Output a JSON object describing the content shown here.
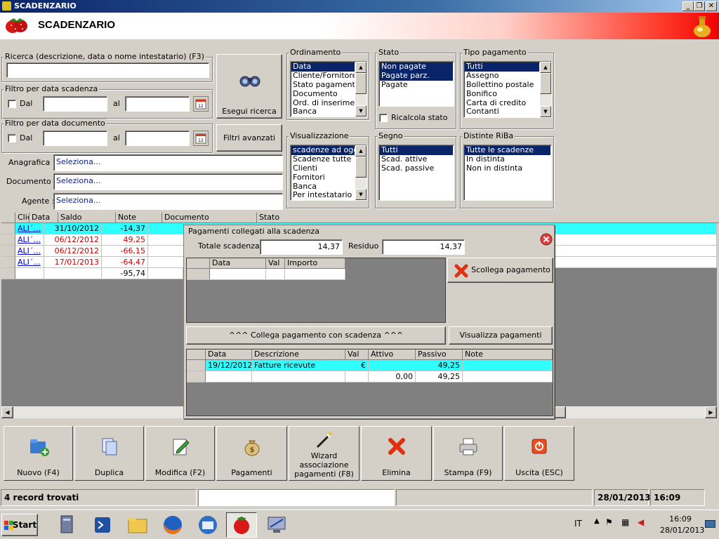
{
  "window": {
    "title": "SCADENZARIO",
    "header_title": "SCADENZARIO"
  },
  "search": {
    "group_label": "Ricerca (descrizione, data o nome intestatario) (F3)",
    "value": "",
    "button_label": "Esegui ricerca",
    "advanced_label": "Filtri avanzati"
  },
  "filter_due": {
    "group_label": "Filtro per data scadenza",
    "check_label": "Dal",
    "to_label": "al",
    "from_value": "",
    "to_value": ""
  },
  "filter_doc": {
    "group_label": "Filtro per data documento",
    "check_label": "Dal",
    "to_label": "al",
    "from_value": "",
    "to_value": ""
  },
  "anagrafica": {
    "label": "Anagrafica :",
    "value": "Seleziona..."
  },
  "documento": {
    "label": "Documento :",
    "value": "Seleziona..."
  },
  "agente": {
    "label": "Agente :",
    "value": "Seleziona..."
  },
  "ordinamento": {
    "label": "Ordinamento",
    "items": [
      "Data",
      "Cliente/Fornitore",
      "Stato pagamento",
      "Documento",
      "Ord. di inserimento",
      "Banca"
    ],
    "selected": [
      0
    ]
  },
  "stato": {
    "label": "Stato",
    "items": [
      "Non pagate",
      "Pagate parz.",
      "Pagate"
    ],
    "selected": [
      0,
      1
    ],
    "ricalcola_label": "Ricalcola stato"
  },
  "tipo_pagamento": {
    "label": "Tipo pagamento",
    "items": [
      "Tutti",
      "Assegno",
      "Bollettino postale",
      "Bonifico",
      "Carta di credito",
      "Contanti"
    ],
    "selected": [
      0
    ]
  },
  "visualizzazione": {
    "label": "Visualizzazione",
    "items": [
      "scadenze ad oggi",
      "Scadenze tutte",
      "Clienti",
      "Fornitori",
      "Banca",
      "Per intestatario"
    ],
    "selected": [
      0
    ]
  },
  "segno": {
    "label": "Segno",
    "items": [
      "Tutti",
      "Scad. attive",
      "Scad. passive"
    ],
    "selected": [
      0
    ]
  },
  "distinte": {
    "label": "Distinte RiBa",
    "items": [
      "Tutte le scadenze",
      "In distinta",
      "Non in distinta"
    ],
    "selected": [
      0
    ]
  },
  "main_grid": {
    "columns": [
      "Client...",
      "Data",
      "Saldo",
      "Note",
      "Documento",
      "Stato"
    ],
    "rows": [
      {
        "client": "ALI´...",
        "date": "31/10/2012",
        "saldo": "-14,37",
        "color": "black",
        "selected": true
      },
      {
        "client": "ALI´...",
        "date": "06/12/2012",
        "saldo": "49,25",
        "color": "red",
        "selected": false
      },
      {
        "client": "ALI´...",
        "date": "06/12/2012",
        "saldo": "-66,15",
        "color": "red",
        "selected": false
      },
      {
        "client": "ALI´...",
        "date": "17/01/2013",
        "saldo": "-64,47",
        "color": "red",
        "selected": false
      }
    ],
    "total": "-95,74"
  },
  "panel": {
    "title": "Pagamenti collegati alla scadenza",
    "totale_label": "Totale scadenza :",
    "totale_value": "14,37",
    "residuo_label": "Residuo :",
    "residuo_value": "14,37",
    "small_grid_columns": [
      "Data",
      "Val",
      "Importo"
    ],
    "scollega_label": "Scollega pagamento",
    "collega_label": "^^^ Collega pagamento con scadenza ^^^",
    "visualizza_label": "Visualizza pagamenti",
    "payments_columns": [
      "Data",
      "Descrizione",
      "Val",
      "Attivo",
      "Passivo",
      "Note"
    ],
    "payments_rows": [
      {
        "date": "19/12/2012",
        "desc": "Fatture ricevute",
        "val": "€",
        "attivo": "",
        "passivo": "49,25",
        "note": ""
      }
    ],
    "payments_total": {
      "attivo": "0,00",
      "passivo": "49,25"
    }
  },
  "toolbar": {
    "nuovo": "Nuovo (F4)",
    "duplica": "Duplica",
    "modifica": "Modifica (F2)",
    "pagamenti": "Pagamenti",
    "wizard": "Wizard associazione pagamenti (F8)",
    "elimina": "Elimina",
    "stampa": "Stampa (F9)",
    "uscita": "Uscita (ESC)"
  },
  "status": {
    "records": "4 record trovati",
    "date": "28/01/2013",
    "time": "16:09"
  },
  "taskbar": {
    "start": "Start",
    "lang": "IT",
    "clock_time": "16:09",
    "clock_date": "28/01/2013"
  },
  "colors": {
    "selection": "#0a246a",
    "row_highlight": "#30ffff",
    "negative": "#d00000"
  }
}
